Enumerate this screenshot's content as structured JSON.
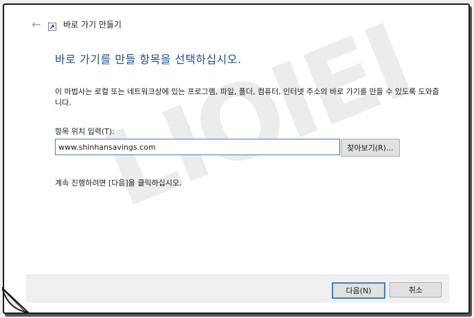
{
  "window": {
    "title": "바로 가기 만들기",
    "back_icon": "back-arrow-icon",
    "app_icon": "shortcut-icon"
  },
  "main": {
    "heading": "바로 가기를 만들 항목을 선택하십시오.",
    "description": "이 마법사는 로컬 또는 네트워크상에 있는 프로그램, 파일, 폴더, 컴퓨터, 인터넷 주소의 바로 가기를 만들 수 있도록 도와줍니다.",
    "location_label": "항목 위치 입력(T):",
    "location_value": "www.shinhansavings.com",
    "browse_label": "찾아보기(R)...",
    "continue_text": "계속 진행하려면 [다음]을 클릭하십시오."
  },
  "footer": {
    "next_label": "다음(N)",
    "cancel_label": "취소"
  },
  "watermark": "LIOIEI",
  "colors": {
    "heading": "#1f4e8c",
    "focus_border": "#3c7fc0",
    "footer_bg": "#f0f0f0",
    "button_bg": "#e1e1e1"
  }
}
